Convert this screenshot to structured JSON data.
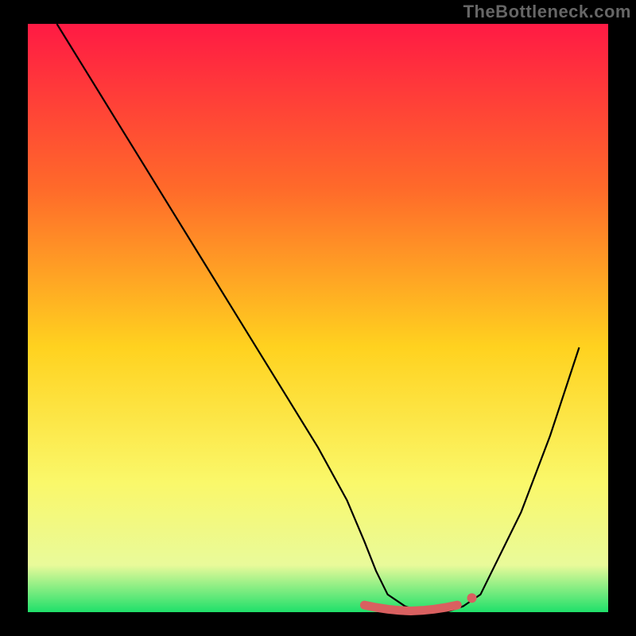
{
  "attribution": "TheBottleneck.com",
  "colors": {
    "frame": "#000000",
    "curve": "#000000",
    "marker_fill": "#d96060",
    "marker_stroke": "#d96060",
    "gradient_top": "#ff1a44",
    "gradient_mid1": "#ff6a2a",
    "gradient_mid2": "#ffd21f",
    "gradient_mid3": "#faf86a",
    "gradient_mid4": "#e9fa9a",
    "gradient_bottom": "#1fe06a"
  },
  "chart_data": {
    "type": "line",
    "title": "",
    "xlabel": "",
    "ylabel": "",
    "xlim": [
      0,
      100
    ],
    "ylim": [
      0,
      100
    ],
    "series": [
      {
        "name": "bottleneck-curve",
        "x": [
          5,
          10,
          15,
          20,
          25,
          30,
          35,
          40,
          45,
          50,
          55,
          58,
          60,
          62,
          65,
          68,
          70,
          72,
          75,
          78,
          80,
          85,
          90,
          95
        ],
        "y": [
          100,
          92,
          84,
          76,
          68,
          60,
          52,
          44,
          36,
          28,
          19,
          12,
          7,
          3,
          1,
          0,
          0,
          0,
          1,
          3,
          7,
          17,
          30,
          45
        ]
      }
    ],
    "markers": {
      "name": "highlight-band",
      "x": [
        58,
        60,
        62,
        64,
        66,
        68,
        70,
        72,
        74
      ],
      "y": [
        1.2,
        0.8,
        0.5,
        0.3,
        0.2,
        0.3,
        0.5,
        0.8,
        1.2
      ]
    }
  }
}
